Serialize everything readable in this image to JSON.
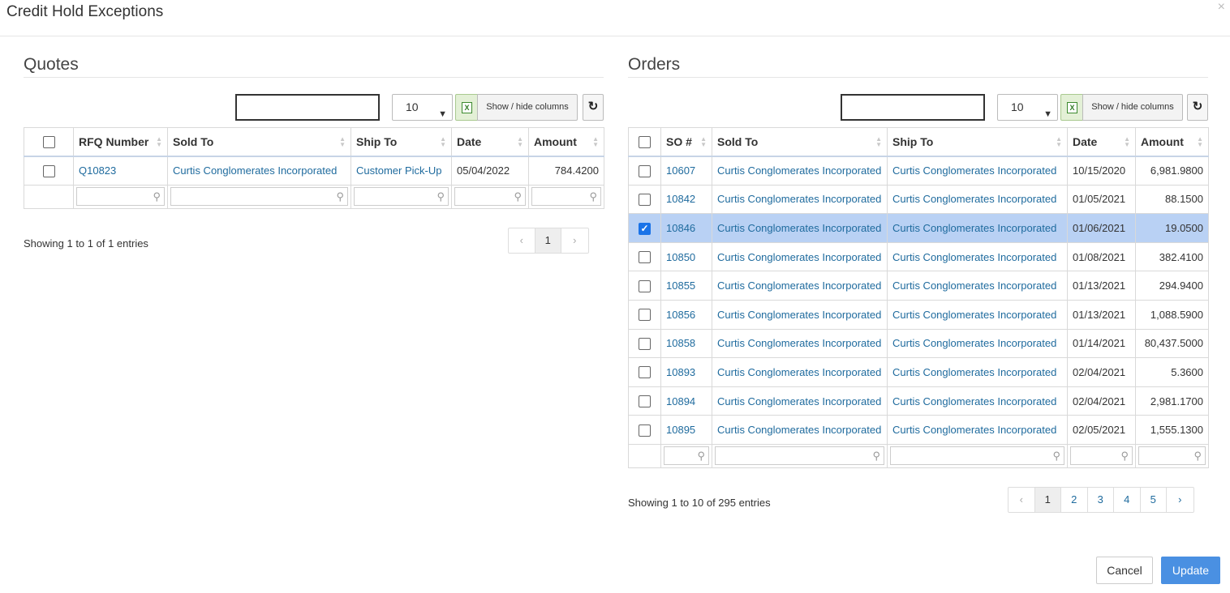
{
  "modal": {
    "title": "Credit Hold Exceptions",
    "close": "×"
  },
  "quotes": {
    "title": "Quotes",
    "search_value": "",
    "page_length": "10",
    "excel_label": "X",
    "show_hide_label": "Show / hide columns",
    "refresh_icon": "↻",
    "columns": [
      "RFQ Number",
      "Sold To",
      "Ship To",
      "Date",
      "Amount"
    ],
    "rows": [
      {
        "id": "Q10823",
        "sold_to": "Curtis Conglomerates Incorporated",
        "ship_to": "Customer Pick-Up",
        "date": "05/04/2022",
        "amount": "784.4200",
        "checked": false
      }
    ],
    "info": "Showing 1 to 1 of 1 entries",
    "pager": [
      "‹",
      "1",
      "›"
    ]
  },
  "orders": {
    "title": "Orders",
    "search_value": "",
    "page_length": "10",
    "excel_label": "X",
    "show_hide_label": "Show / hide columns",
    "refresh_icon": "↻",
    "columns": [
      "SO #",
      "Sold To",
      "Ship To",
      "Date",
      "Amount"
    ],
    "rows": [
      {
        "id": "10607",
        "sold_to": "Curtis Conglomerates Incorporated",
        "ship_to": "Curtis Conglomerates Incorporated",
        "date": "10/15/2020",
        "amount": "6,981.9800",
        "checked": false
      },
      {
        "id": "10842",
        "sold_to": "Curtis Conglomerates Incorporated",
        "ship_to": "Curtis Conglomerates Incorporated",
        "date": "01/05/2021",
        "amount": "88.1500",
        "checked": false
      },
      {
        "id": "10846",
        "sold_to": "Curtis Conglomerates Incorporated",
        "ship_to": "Curtis Conglomerates Incorporated",
        "date": "01/06/2021",
        "amount": "19.0500",
        "checked": true
      },
      {
        "id": "10850",
        "sold_to": "Curtis Conglomerates Incorporated",
        "ship_to": "Curtis Conglomerates Incorporated",
        "date": "01/08/2021",
        "amount": "382.4100",
        "checked": false
      },
      {
        "id": "10855",
        "sold_to": "Curtis Conglomerates Incorporated",
        "ship_to": "Curtis Conglomerates Incorporated",
        "date": "01/13/2021",
        "amount": "294.9400",
        "checked": false
      },
      {
        "id": "10856",
        "sold_to": "Curtis Conglomerates Incorporated",
        "ship_to": "Curtis Conglomerates Incorporated",
        "date": "01/13/2021",
        "amount": "1,088.5900",
        "checked": false
      },
      {
        "id": "10858",
        "sold_to": "Curtis Conglomerates Incorporated",
        "ship_to": "Curtis Conglomerates Incorporated",
        "date": "01/14/2021",
        "amount": "80,437.5000",
        "checked": false
      },
      {
        "id": "10893",
        "sold_to": "Curtis Conglomerates Incorporated",
        "ship_to": "Curtis Conglomerates Incorporated",
        "date": "02/04/2021",
        "amount": "5.3600",
        "checked": false
      },
      {
        "id": "10894",
        "sold_to": "Curtis Conglomerates Incorporated",
        "ship_to": "Curtis Conglomerates Incorporated",
        "date": "02/04/2021",
        "amount": "2,981.1700",
        "checked": false
      },
      {
        "id": "10895",
        "sold_to": "Curtis Conglomerates Incorporated",
        "ship_to": "Curtis Conglomerates Incorporated",
        "date": "02/05/2021",
        "amount": "1,555.1300",
        "checked": false
      }
    ],
    "info": "Showing 1 to 10 of 295 entries",
    "pager": [
      "‹",
      "1",
      "2",
      "3",
      "4",
      "5",
      "›"
    ]
  },
  "footer": {
    "cancel_label": "Cancel",
    "update_label": "Update"
  },
  "colors": {
    "link": "#1f6b9e",
    "selected_row": "#b9d1f4",
    "primary_button": "#4a90e2"
  }
}
